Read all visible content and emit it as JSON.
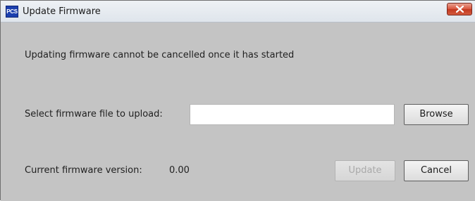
{
  "window": {
    "title": "Update Firmware",
    "app_icon_text": "PCS",
    "close_icon": "close-x-icon",
    "accent_close": "#d9573f"
  },
  "dialog": {
    "warning_text": "Updating firmware cannot be cancelled once it has started",
    "select_label": "Select firmware file to upload:",
    "file_input_value": "",
    "browse_label": "Browse",
    "version_label": "Current firmware version:",
    "version_value": "0.00",
    "update_label": "Update",
    "update_enabled": false,
    "cancel_label": "Cancel"
  }
}
